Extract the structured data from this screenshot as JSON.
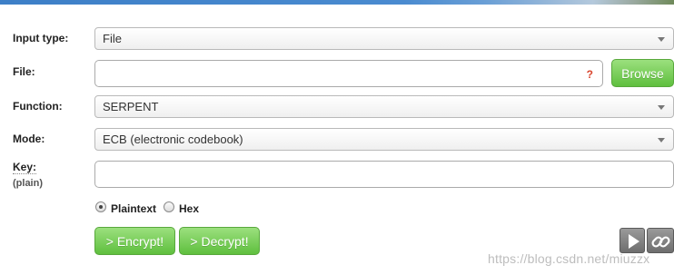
{
  "form": {
    "input_type": {
      "label": "Input type:",
      "value": "File"
    },
    "file": {
      "label": "File:",
      "help": "?",
      "browse_label": "Browse"
    },
    "function": {
      "label": "Function:",
      "value": "SERPENT"
    },
    "mode": {
      "label": "Mode:",
      "value": "ECB (electronic codebook)"
    },
    "key": {
      "label": "Key:",
      "sublabel": "(plain)",
      "value": ""
    },
    "format": {
      "options": [
        "Plaintext",
        "Hex"
      ],
      "selected": "Plaintext"
    },
    "encrypt_label": "> Encrypt!",
    "decrypt_label": "> Decrypt!"
  },
  "toolbar": {
    "icons": [
      "play-icon",
      "link-icon"
    ]
  },
  "watermark": "https://blog.csdn.net/miuzzx",
  "colors": {
    "accent_green": "#5fbf3e",
    "banner_blue": "#3d7fc7",
    "help_red": "#d9462f"
  }
}
